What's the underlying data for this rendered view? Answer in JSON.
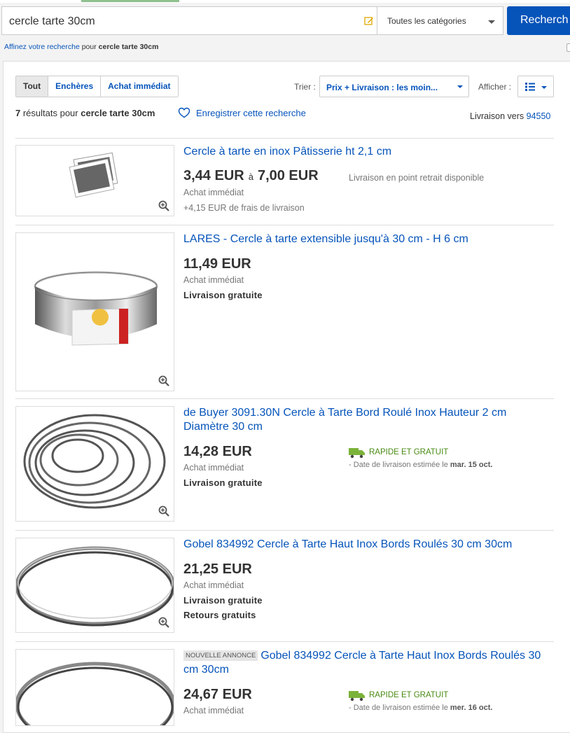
{
  "search": {
    "query": "cercle tarte 30cm",
    "category": "Toutes les catégories",
    "button": "Recherch"
  },
  "refine": {
    "link": "Affinez votre recherche",
    "mid": " pour ",
    "term": "cercle tarte 30cm"
  },
  "tabs": [
    "Tout",
    "Enchères",
    "Achat immédiat"
  ],
  "sort": {
    "label": "Trier :",
    "value": "Prix + Livraison : les moin...",
    "view_label": "Afficher :"
  },
  "results": {
    "count": "7",
    "text": " résultats pour ",
    "term": "cercle tarte 30cm",
    "save": "Enregistrer cette recherche",
    "delivery_label": "Livraison vers ",
    "delivery_zip": "94550"
  },
  "items": [
    {
      "title": "Cercle à tarte en inox Pâtisserie ht 2,1 cm",
      "price_low": "3,44 EUR",
      "price_sep": "à",
      "price_high": "7,00 EUR",
      "note": "Livraison en point retrait disponible",
      "format": "Achat immédiat",
      "shipping": "+4,15 EUR de frais de livraison"
    },
    {
      "title": "LARES - Cercle à tarte extensible jusqu'à 30 cm - H 6 cm",
      "price": "11,49 EUR",
      "format": "Achat immédiat",
      "shipping": "Livraison gratuite"
    },
    {
      "title": "de Buyer 3091.30N Cercle à Tarte Bord Roulé Inox Hauteur 2 cm Diamètre 30 cm",
      "price": "14,28 EUR",
      "format": "Achat immédiat",
      "shipping": "Livraison gratuite",
      "fast": "RAPIDE ET GRATUIT",
      "est_text": "- Date de livraison estimée le ",
      "est_date": "mar. 15 oct."
    },
    {
      "title": "Gobel 834992 Cercle à Tarte Haut Inox Bords Roulés 30 cm 30cm",
      "price": "21,25 EUR",
      "format": "Achat immédiat",
      "shipping": "Livraison gratuite",
      "returns": "Retours gratuits"
    },
    {
      "badge": "NOUVELLE ANNONCE",
      "title": "Gobel 834992 Cercle à Tarte Haut Inox Bords Roulés 30 cm 30cm",
      "price": "24,67 EUR",
      "format": "Achat immédiat",
      "fast": "RAPIDE ET GRATUIT",
      "est_text": "- Date de livraison estimée le ",
      "est_date": "mer. 16 oct."
    }
  ],
  "colors": {
    "link": "#0654ba",
    "button": "#0654ba",
    "fast_green": "#4a8b14"
  }
}
